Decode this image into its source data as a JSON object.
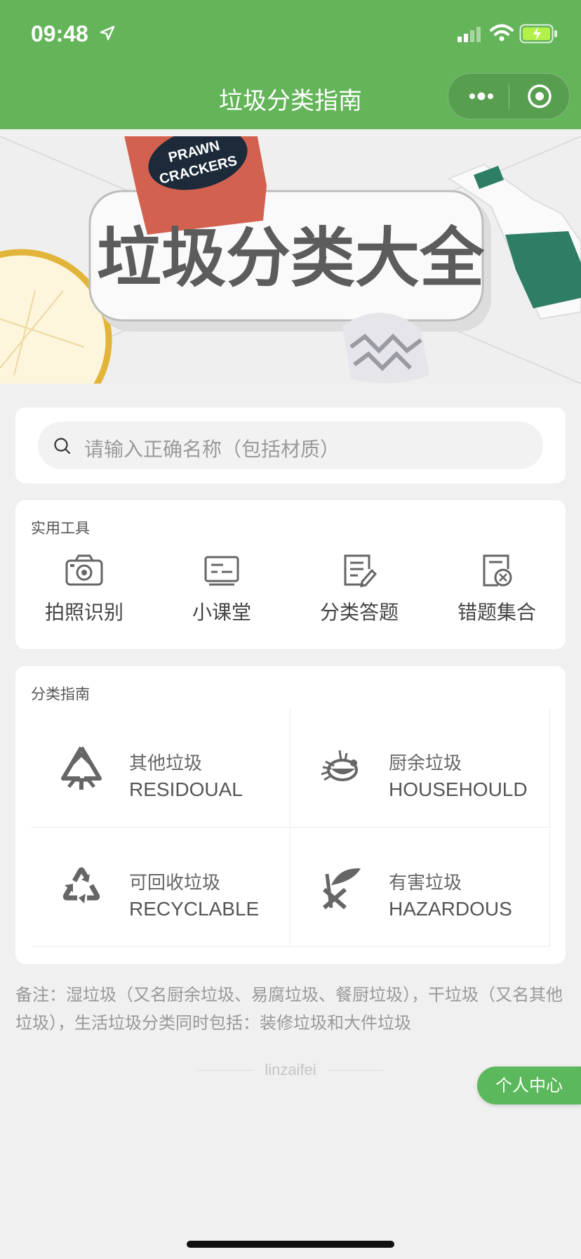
{
  "status_bar": {
    "time": "09:48"
  },
  "nav": {
    "title": "垃圾分类指南"
  },
  "banner": {
    "title": "垃圾分类大全",
    "bag_text_line1": "PRAWN",
    "bag_text_line2": "CRACKERS"
  },
  "search": {
    "placeholder": "请输入正确名称（包括材质）"
  },
  "tools": {
    "title": "实用工具",
    "items": [
      {
        "label": "拍照识别",
        "icon": "camera-icon"
      },
      {
        "label": "小课堂",
        "icon": "classroom-icon"
      },
      {
        "label": "分类答题",
        "icon": "quiz-icon"
      },
      {
        "label": "错题集合",
        "icon": "wrong-questions-icon"
      }
    ]
  },
  "guide": {
    "title": "分类指南",
    "items": [
      {
        "zh": "其他垃圾",
        "en": "RESIDOUAL",
        "icon": "residual-icon"
      },
      {
        "zh": "厨余垃圾",
        "en": "HOUSEHOULD",
        "icon": "kitchen-waste-icon"
      },
      {
        "zh": "可回收垃圾",
        "en": "RECYCLABLE",
        "icon": "recycle-icon"
      },
      {
        "zh": "有害垃圾",
        "en": "HAZARDOUS",
        "icon": "hazardous-icon"
      }
    ]
  },
  "note": "备注：湿垃圾（又名厨余垃圾、易腐垃圾、餐厨垃圾），干垃圾（又名其他垃圾），生活垃圾分类同时包括：装修垃圾和大件垃圾",
  "footer": {
    "text": "linzaifei"
  },
  "personal_center": {
    "label": "个人中心"
  },
  "colors": {
    "brand": "#64b45a",
    "button": "#5cb85c",
    "background": "#f0f0f0"
  }
}
